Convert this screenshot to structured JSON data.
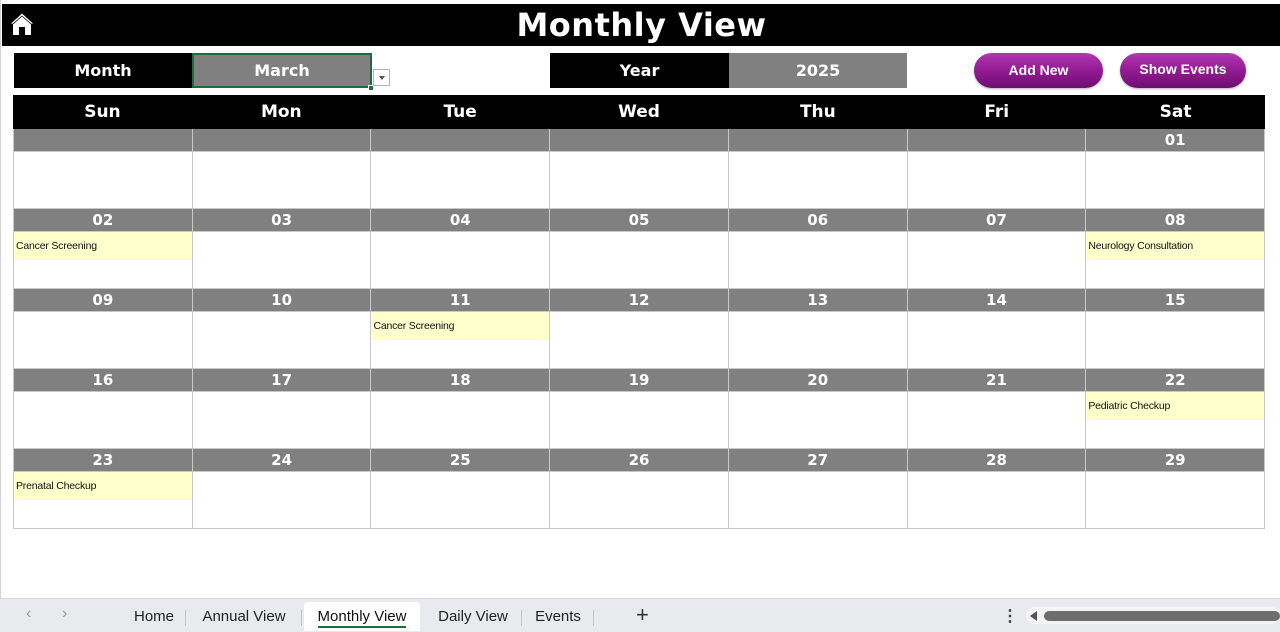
{
  "header": {
    "title": "Monthly View",
    "home_icon": "home-icon"
  },
  "controls": {
    "month_label": "Month",
    "month_value": "March",
    "year_label": "Year",
    "year_value": "2025",
    "add_new_label": "Add New",
    "show_events_label": "Show Events",
    "accent_color": "#8e1a8e"
  },
  "calendar": {
    "weekdays": [
      "Sun",
      "Mon",
      "Tue",
      "Wed",
      "Thu",
      "Fri",
      "Sat"
    ],
    "weeks": [
      [
        {
          "day": ""
        },
        {
          "day": ""
        },
        {
          "day": ""
        },
        {
          "day": ""
        },
        {
          "day": ""
        },
        {
          "day": ""
        },
        {
          "day": "01"
        }
      ],
      [
        {
          "day": "02",
          "event": "Cancer Screening"
        },
        {
          "day": "03"
        },
        {
          "day": "04"
        },
        {
          "day": "05"
        },
        {
          "day": "06"
        },
        {
          "day": "07"
        },
        {
          "day": "08",
          "event": "Neurology Consultation"
        }
      ],
      [
        {
          "day": "09"
        },
        {
          "day": "10"
        },
        {
          "day": "11",
          "event": "Cancer Screening"
        },
        {
          "day": "12"
        },
        {
          "day": "13"
        },
        {
          "day": "14"
        },
        {
          "day": "15"
        }
      ],
      [
        {
          "day": "16"
        },
        {
          "day": "17"
        },
        {
          "day": "18"
        },
        {
          "day": "19"
        },
        {
          "day": "20"
        },
        {
          "day": "21"
        },
        {
          "day": "22",
          "event": "Pediatric Checkup"
        }
      ],
      [
        {
          "day": "23",
          "event": "Prenatal Checkup"
        },
        {
          "day": "24"
        },
        {
          "day": "25"
        },
        {
          "day": "26"
        },
        {
          "day": "27"
        },
        {
          "day": "28"
        },
        {
          "day": "29"
        }
      ]
    ],
    "event_color": "#ffffcc",
    "day_header_color": "#808080"
  },
  "sheet_tabs": {
    "tabs": [
      "Home",
      "Annual View",
      "Monthly View",
      "Daily View",
      "Events"
    ],
    "active": "Monthly View",
    "add_label": "+",
    "prev_label": "‹",
    "next_label": "›",
    "more_label": "⋮"
  }
}
